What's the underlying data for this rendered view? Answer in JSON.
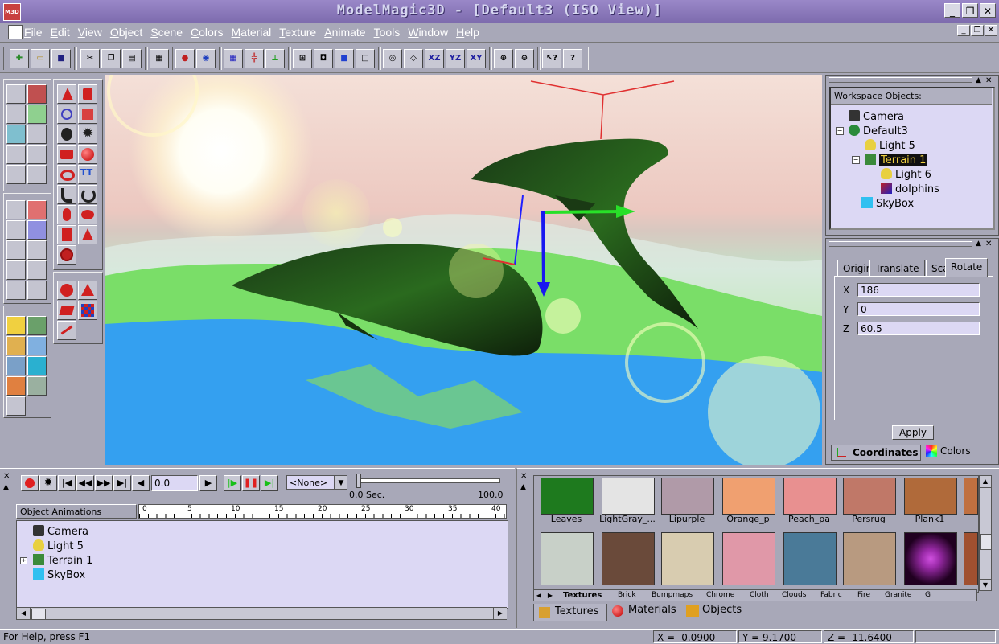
{
  "window": {
    "title": "ModelMagic3D - [Default3 (ISO View)]",
    "app_icon_text": "M3D"
  },
  "menu": {
    "items": [
      "File",
      "Edit",
      "View",
      "Object",
      "Scene",
      "Colors",
      "Material",
      "Texture",
      "Animate",
      "Tools",
      "Window",
      "Help"
    ]
  },
  "toolbar": {
    "labels": {
      "xz": "XZ",
      "yz": "YZ",
      "xy": "XY"
    }
  },
  "workspace": {
    "header": "Workspace Objects:",
    "items": [
      {
        "label": "Camera",
        "icon": "camera-icon"
      },
      {
        "label": "Default3",
        "icon": "globe-icon"
      },
      {
        "label": "Light 5",
        "icon": "light-bulb-icon"
      },
      {
        "label": "Terrain 1",
        "icon": "terrain-icon",
        "selected": true
      },
      {
        "label": "Light 6",
        "icon": "light-bulb-icon"
      },
      {
        "label": "dolphins",
        "icon": "mesh-icon"
      },
      {
        "label": "SkyBox",
        "icon": "skybox-icon"
      }
    ]
  },
  "transform": {
    "tabs": [
      "Origin",
      "Translate",
      "Scale",
      "Rotate"
    ],
    "active_tab": "Rotate",
    "fields": [
      {
        "label": "X",
        "value": "186"
      },
      {
        "label": "Y",
        "value": "0"
      },
      {
        "label": "Z",
        "value": "60.5"
      }
    ],
    "apply_label": "Apply",
    "bottom_tabs": [
      "Coordinates",
      "Colors"
    ]
  },
  "animation": {
    "frame_value": "0.0",
    "track_select": "<None>",
    "time_start": "0.0 Sec.",
    "time_end": "100.0",
    "list_header": "Object Animations",
    "ruler_ticks": [
      "0",
      "5",
      "10",
      "15",
      "20",
      "25",
      "30",
      "35",
      "40"
    ],
    "objects": [
      {
        "label": "Camera",
        "icon": "camera-icon"
      },
      {
        "label": "Light 5",
        "icon": "light-bulb-icon"
      },
      {
        "label": "Terrain 1",
        "icon": "terrain-icon",
        "expandable": true
      },
      {
        "label": "SkyBox",
        "icon": "skybox-icon"
      }
    ]
  },
  "textures": {
    "row1": [
      {
        "label": "Leaves",
        "color": "#1e7a1e"
      },
      {
        "label": "LightGray_...",
        "color": "#e4e4e4"
      },
      {
        "label": "Lipurple",
        "color": "#b09aa8"
      },
      {
        "label": "Orange_p",
        "color": "#f0a070"
      },
      {
        "label": "Peach_pa",
        "color": "#e89090"
      },
      {
        "label": "Persrug",
        "color": "#c07868"
      },
      {
        "label": "Plank1",
        "color": "#b06a3a"
      }
    ],
    "row2": [
      {
        "color": "#c8d0c8"
      },
      {
        "color": "#6a4a3a"
      },
      {
        "color": "#d8ccb0"
      },
      {
        "color": "#e098a8"
      },
      {
        "color": "#4a7a98"
      },
      {
        "color": "#b89a80"
      },
      {
        "color": "#9a2aa8"
      }
    ],
    "category_tabs": [
      "Textures",
      "Brick",
      "Bumpmaps",
      "Chrome",
      "Cloth",
      "Clouds",
      "Fabric",
      "Fire",
      "Granite",
      "G"
    ],
    "bottom_tabs": [
      "Textures",
      "Materials",
      "Objects"
    ]
  },
  "status": {
    "help": "For Help, press F1",
    "x": "X = -0.0900",
    "y": "Y = 9.1700",
    "z": "Z = -11.6400"
  }
}
